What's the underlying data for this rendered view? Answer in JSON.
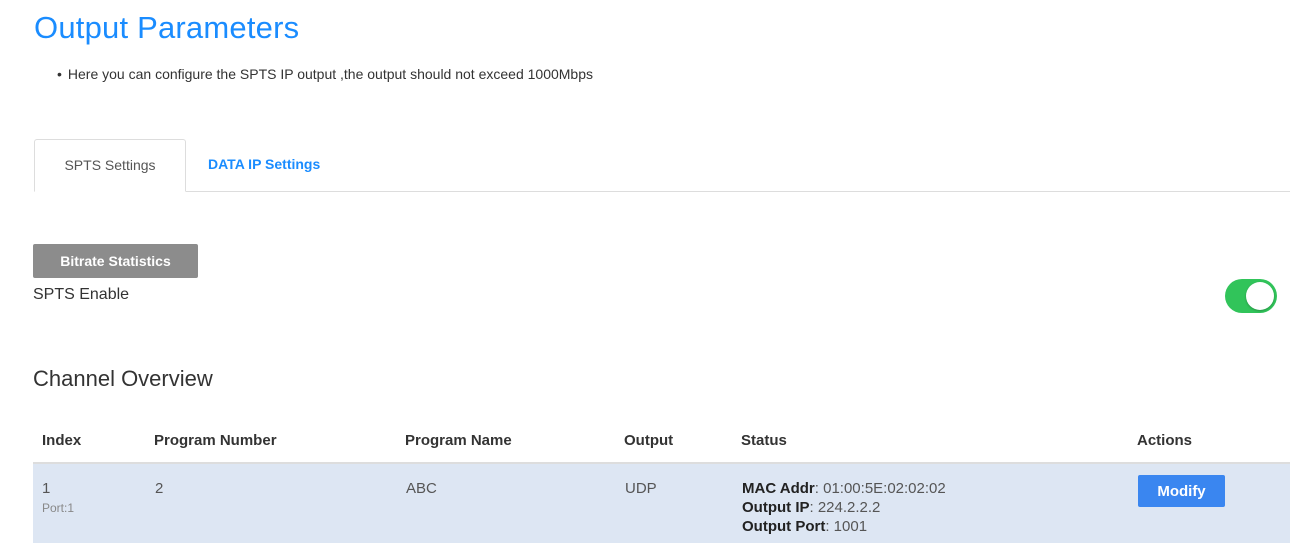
{
  "page": {
    "title": "Output Parameters",
    "intro_bullet": "•",
    "intro_text": "Here you can configure the SPTS IP output ,the output should not exceed 1000Mbps"
  },
  "tabs": [
    {
      "label": "SPTS Settings",
      "active": true
    },
    {
      "label": "DATA IP Settings",
      "active": false
    }
  ],
  "spts": {
    "bitrate_button": "Bitrate Statistics",
    "enable_label": "SPTS Enable",
    "enabled": true,
    "toggle_color": "#31c45a"
  },
  "channel_overview": {
    "title": "Channel Overview",
    "columns": [
      "Index",
      "Program Number",
      "Program Name",
      "Output",
      "Status",
      "Actions"
    ],
    "rows": [
      {
        "index": "1",
        "port": "Port:1",
        "program_number": "2",
        "program_name": "ABC",
        "output": "UDP",
        "mac_label": "MAC Addr",
        "mac_value": ": 01:00:5E:02:02:02",
        "ip_label": "Output IP",
        "ip_value": ": 224.2.2.2",
        "port_label": "Output Port",
        "port_value": ": 1001",
        "action": "Modify"
      }
    ]
  },
  "colors": {
    "accent": "#1a8cff",
    "row_highlight": "#dde6f3",
    "button_gray": "#8c8c8c",
    "button_blue": "#3a86f0"
  }
}
